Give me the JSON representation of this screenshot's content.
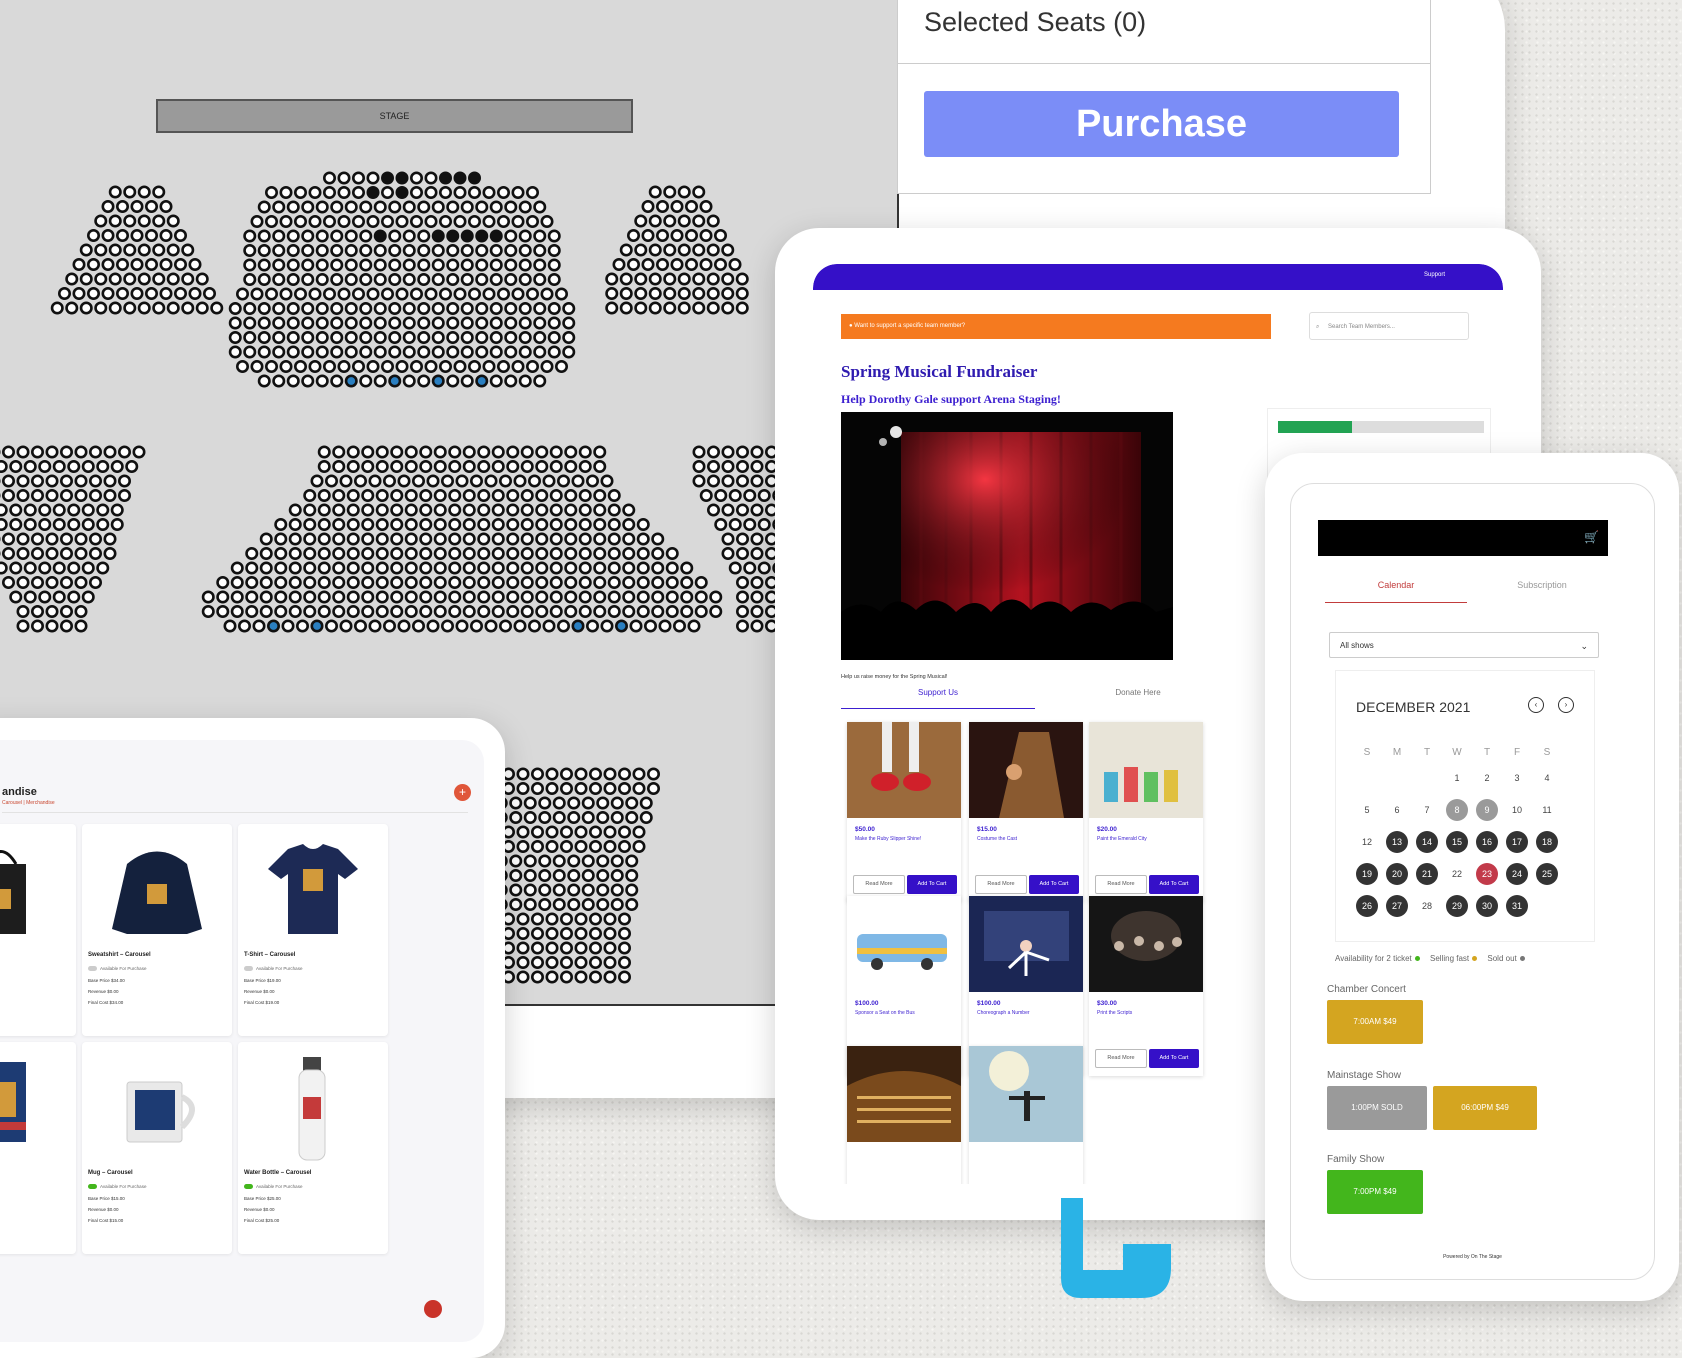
{
  "seatmap": {
    "stage_label": "STAGE",
    "selected_title": "Selected Seats (0)",
    "purchase_label": "Purchase",
    "colors": {
      "seat_open": "#ffffff",
      "seat_taken": "#111111",
      "seat_selected": "#2a7fc1",
      "seat_grey": "#888888"
    }
  },
  "merch": {
    "title": "andise",
    "breadcrumb": "Carousel  |  Merchandise",
    "add_icon": "plus-icon",
    "products": [
      {
        "name": "Carousel",
        "avail": "Available For Purchase",
        "base": "e Price  $19.00",
        "rev": "e  $1.00",
        "fee": "t  $20.00",
        "icon": "tote-bag-icon"
      },
      {
        "name": "Sweatshirt – Carousel",
        "avail": "Available For Purchase",
        "base": "Base Price  $34.00",
        "rev": "Revenue  $0.00",
        "fee": "Final Cost  $34.00",
        "icon": "hoodie-icon"
      },
      {
        "name": "T-Shirt – Carousel",
        "avail": "Available For Purchase",
        "base": "Base Price  $19.00",
        "rev": "Revenue  $0.00",
        "fee": "Final Cost  $19.00",
        "icon": "tshirt-icon"
      },
      {
        "name": "– Carousel",
        "avail": "Available For Purchase",
        "base": "e Price  $15.00",
        "rev": "e  $0.00",
        "fee": "t  $15.00",
        "icon": "poster-icon"
      },
      {
        "name": "Mug – Carousel",
        "avail": "Available For Purchase",
        "base": "Base Price  $15.00",
        "rev": "Revenue  $0.00",
        "fee": "Final Cost  $15.00",
        "icon": "mug-icon"
      },
      {
        "name": "Water Bottle – Carousel",
        "avail": "Available For Purchase",
        "base": "Base Price  $25.00",
        "rev": "Revenue  $0.00",
        "fee": "Final Cost  $25.00",
        "icon": "water-bottle-icon"
      }
    ]
  },
  "fund": {
    "nav_support": "Support",
    "alert": "Want to support a specific team member?",
    "search_placeholder": "Search Team Members...",
    "title": "Spring Musical Fundraiser",
    "subtitle": "Help Dorothy Gale support Arena Staging!",
    "caption": "Help us raise money for the Spring Musical!",
    "tab_support": "Support Us",
    "tab_donate": "Donate Here",
    "progress": 0.36,
    "read_more": "Read More",
    "add_to_cart": "Add To Cart",
    "items": [
      {
        "price": "$50.00",
        "desc": "Make the Ruby Slipper Shine!",
        "img": "red-shoes"
      },
      {
        "price": "$15.00",
        "desc": "Costume the Cast",
        "img": "costume"
      },
      {
        "price": "$20.00",
        "desc": "Paint the Emerald City",
        "img": "paint"
      },
      {
        "price": "$100.00",
        "desc": "Sponsor a Seat on the Bus",
        "img": "bus"
      },
      {
        "price": "$100.00",
        "desc": "Choreograph a Number",
        "img": "dance"
      },
      {
        "price": "$30.00",
        "desc": "Print the Scripts",
        "img": "stage-crowd"
      }
    ]
  },
  "phone": {
    "tab_calendar": "Calendar",
    "tab_subscription": "Subscription",
    "select_value": "All shows",
    "month": "DECEMBER 2021",
    "dow": [
      "S",
      "M",
      "T",
      "W",
      "T",
      "F",
      "S"
    ],
    "legend_avail": "Availability for 2 ticket",
    "legend_fast": "Selling fast",
    "legend_sold": "Sold out",
    "shows": [
      {
        "name": "Chamber Concert",
        "times": [
          {
            "label": "7:00AM  $49",
            "color": "#d4a520"
          }
        ]
      },
      {
        "name": "Mainstage Show",
        "times": [
          {
            "label": "1:00PM  SOLD",
            "color": "#9a9a9a"
          },
          {
            "label": "06:00PM  $49",
            "color": "#d4a520"
          }
        ]
      },
      {
        "name": "Family Show",
        "times": [
          {
            "label": "7:00PM  $49",
            "color": "#43b61c"
          }
        ]
      }
    ],
    "footer": "Powered by On The Stage"
  }
}
